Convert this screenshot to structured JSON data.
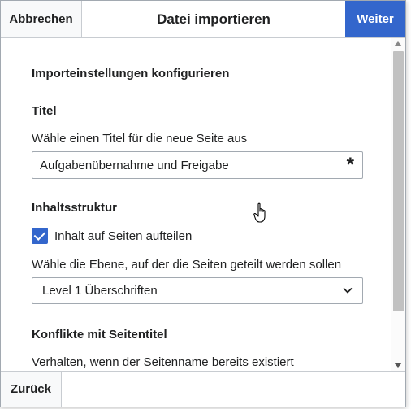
{
  "dialog": {
    "title": "Datei importieren",
    "cancel_label": "Abbrechen",
    "next_label": "Weiter",
    "back_label": "Zurück"
  },
  "form": {
    "section_heading": "Importeinstellungen konfigurieren",
    "title_heading": "Titel",
    "title_help": "Wähle einen Titel für die neue Seite aus",
    "title_value": "Aufgabenübernahme und Freigabe",
    "required_marker": "*",
    "structure_heading": "Inhaltsstruktur",
    "split_checkbox_label": "Inhalt auf Seiten aufteilen",
    "split_checked": true,
    "level_help": "Wähle die Ebene, auf der die Seiten geteilt werden sollen",
    "level_selected": "Level 1 Überschriften",
    "conflicts_heading": "Konflikte mit Seitentitel",
    "conflicts_help": "Verhalten, wenn der Seitenname bereits existiert"
  },
  "colors": {
    "accent": "#3366cc",
    "border": "#a2a9b1"
  }
}
